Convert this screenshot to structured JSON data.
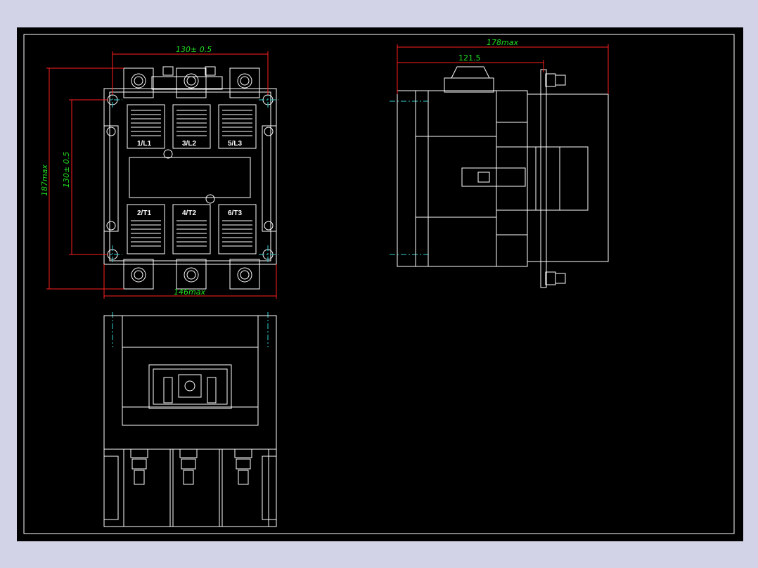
{
  "colors": {
    "background": "#000000",
    "frame": "#ffffff",
    "outline": "#ffffff",
    "dimension_line": "#ff2020",
    "dimension_text": "#22dd22",
    "center_line": "#30d0d0",
    "window_border": "#d3d3e8"
  },
  "front_view": {
    "line_terminals": [
      "1/L1",
      "3/L2",
      "5/L3"
    ],
    "load_terminals": [
      "2/T1",
      "4/T2",
      "6/T3"
    ]
  },
  "dimensions": {
    "front_width_mounting": "130± 0.5",
    "front_height_mounting": "130± 0.5",
    "front_height_max": "187max",
    "front_width_max": "146max",
    "side_depth_max": "178max",
    "side_depth_mount": "121.5"
  }
}
